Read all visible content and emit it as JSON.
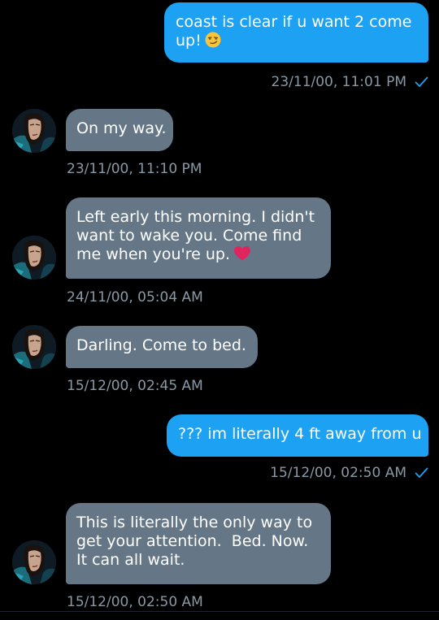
{
  "colors": {
    "background": "#000000",
    "outgoing_bubble": "#1da1f2",
    "incoming_bubble": "#657786",
    "timestamp": "#8899a6",
    "read_check": "#1da1f2",
    "heart": "#e0245e"
  },
  "messages": [
    {
      "direction": "outgoing",
      "lines": [
        "coast is clear if u want 2 come",
        "up!"
      ],
      "emoji": "smirking-face-emoji",
      "timestamp": "23/11/00, 11:01 PM",
      "read": true
    },
    {
      "direction": "incoming",
      "lines": [
        "On my way."
      ],
      "timestamp": "23/11/00, 11:10 PM"
    },
    {
      "direction": "incoming",
      "lines": [
        "Left early this morning. I didn't",
        "want to wake you. Come find",
        "me when you're up."
      ],
      "emoji": "red-heart-emoji",
      "timestamp": "24/11/00, 05:04 AM"
    },
    {
      "direction": "incoming",
      "lines": [
        "Darling. Come to bed."
      ],
      "timestamp": "15/12/00, 02:45 AM"
    },
    {
      "direction": "outgoing",
      "lines": [
        "??? im literally 4 ft away from u"
      ],
      "timestamp": "15/12/00, 02:50 AM",
      "read": true
    },
    {
      "direction": "incoming",
      "lines": [
        "This is literally the only way to",
        "get your attention.  Bed. Now.",
        "It can all wait."
      ],
      "timestamp": "15/12/00, 02:50 AM"
    }
  ]
}
